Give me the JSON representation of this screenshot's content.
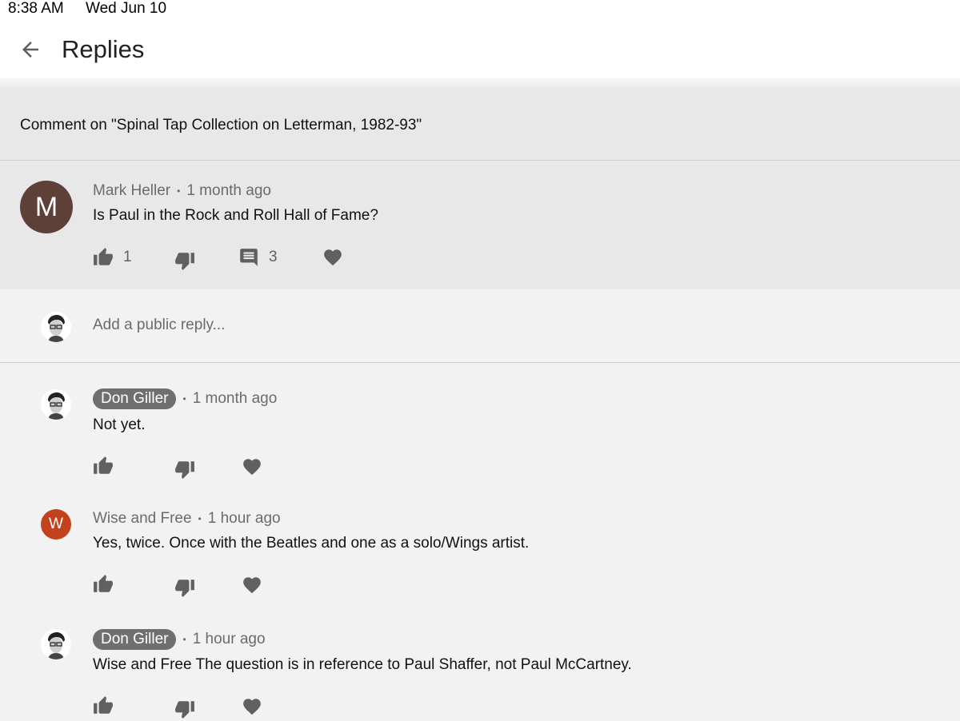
{
  "status_bar": {
    "time": "8:38 AM",
    "date": "Wed Jun 10"
  },
  "header": {
    "title": "Replies",
    "back_icon": "arrow-back-icon"
  },
  "context": {
    "text": "Comment on \"Spinal Tap Collection on Letterman, 1982-93\""
  },
  "parent_comment": {
    "avatar_letter": "M",
    "avatar_color": "#5d4037",
    "author": "Mark Heller",
    "time": "1 month ago",
    "text": "Is Paul in the Rock and Roll Hall of Fame?",
    "likes": "1",
    "replies": "3"
  },
  "reply_box": {
    "placeholder": "Add a public reply..."
  },
  "replies": [
    {
      "author": "Don Giller",
      "is_channel_owner": true,
      "time": "1 month ago",
      "text": "Not yet."
    },
    {
      "author": "Wise and Free",
      "is_channel_owner": false,
      "avatar_letter": "W",
      "avatar_color": "#c1421c",
      "time": "1 hour ago",
      "text": "Yes, twice. Once with the Beatles and one as a solo/Wings artist."
    },
    {
      "author": "Don Giller",
      "is_channel_owner": true,
      "time": "1 hour ago",
      "text": "Wise and Free The question is in reference to Paul Shaffer, not Paul McCartney."
    }
  ],
  "separator": "•",
  "icons": [
    "thumb-up-icon",
    "thumb-down-icon",
    "comment-icon",
    "heart-icon"
  ]
}
